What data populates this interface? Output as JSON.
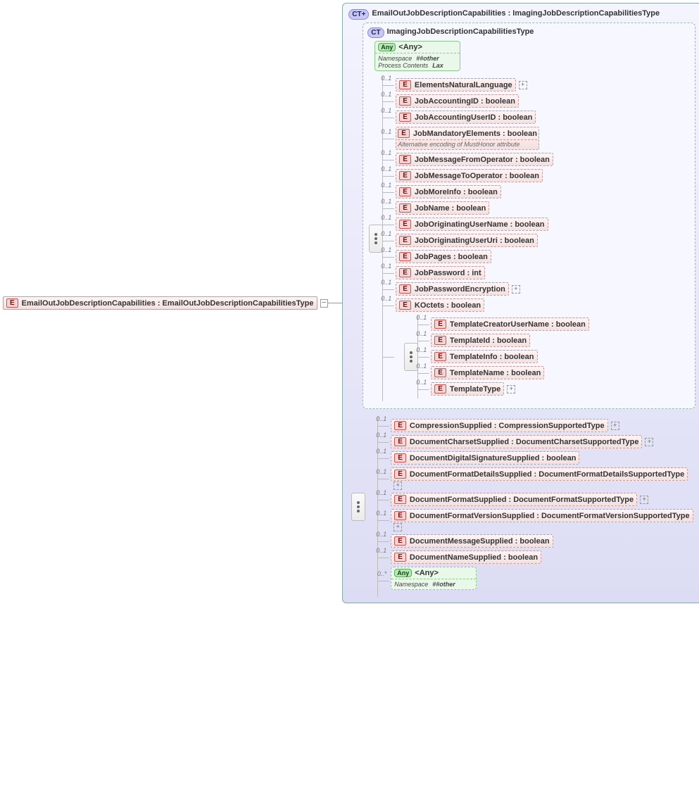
{
  "root": {
    "badge": "E",
    "label": "EmailOutJobDescriptionCapabilities : EmailOutJobDescriptionCapabilitiesType"
  },
  "outer": {
    "ct_badge": "CT+",
    "header": "EmailOutJobDescriptionCapabilities : ImagingJobDescriptionCapabilitiesType"
  },
  "inner": {
    "ct_badge": "CT",
    "header": "ImagingJobDescriptionCapabilitiesType"
  },
  "any_top": {
    "badge": "Any",
    "label": "<Any>",
    "ns_label": "Namespace",
    "ns_value": "##other",
    "pc_label": "Process Contents",
    "pc_value": "Lax"
  },
  "occ": {
    "opt": "0..1",
    "many": "0..*"
  },
  "inner_items": [
    {
      "label": "ElementsNaturalLanguage",
      "plus": true
    },
    {
      "label": "JobAccountingID : boolean"
    },
    {
      "label": "JobAccountingUserID : boolean"
    },
    {
      "label": "JobMandatoryElements : boolean",
      "note": "Alternative encoding of MustHonor attribute"
    },
    {
      "label": "JobMessageFromOperator : boolean"
    },
    {
      "label": "JobMessageToOperator : boolean"
    },
    {
      "label": "JobMoreInfo : boolean"
    },
    {
      "label": "JobName : boolean"
    },
    {
      "label": "JobOriginatingUserName : boolean"
    },
    {
      "label": "JobOriginatingUserUri : boolean"
    },
    {
      "label": "JobPages : boolean"
    },
    {
      "label": "JobPassword : int"
    },
    {
      "label": "JobPasswordEncryption",
      "plus": true
    },
    {
      "label": "KOctets  : boolean"
    }
  ],
  "template_items": [
    {
      "label": "TemplateCreatorUserName : boolean"
    },
    {
      "label": "TemplateId : boolean"
    },
    {
      "label": "TemplateInfo : boolean"
    },
    {
      "label": "TemplateName : boolean"
    },
    {
      "label": "TemplateType",
      "plus": true
    }
  ],
  "outer_items": [
    {
      "label": "CompressionSupplied : CompressionSupportedType",
      "plus": true
    },
    {
      "label": "DocumentCharsetSupplied : DocumentCharsetSupportedType",
      "plus": true
    },
    {
      "label": "DocumentDigitalSignatureSupplied : boolean"
    },
    {
      "label": "DocumentFormatDetailsSupplied : DocumentFormatDetailsSupportedType",
      "plus": true
    },
    {
      "label": "DocumentFormatSupplied : DocumentFormatSupportedType",
      "plus": true
    },
    {
      "label": "DocumentFormatVersionSupplied : DocumentFormatVersionSupportedType",
      "plus": true
    },
    {
      "label": "DocumentMessageSupplied : boolean"
    },
    {
      "label": "DocumentNameSupplied : boolean"
    }
  ],
  "any_bottom": {
    "badge": "Any",
    "label": "<Any>",
    "ns_label": "Namespace",
    "ns_value": "##other"
  },
  "badge_e": "E"
}
